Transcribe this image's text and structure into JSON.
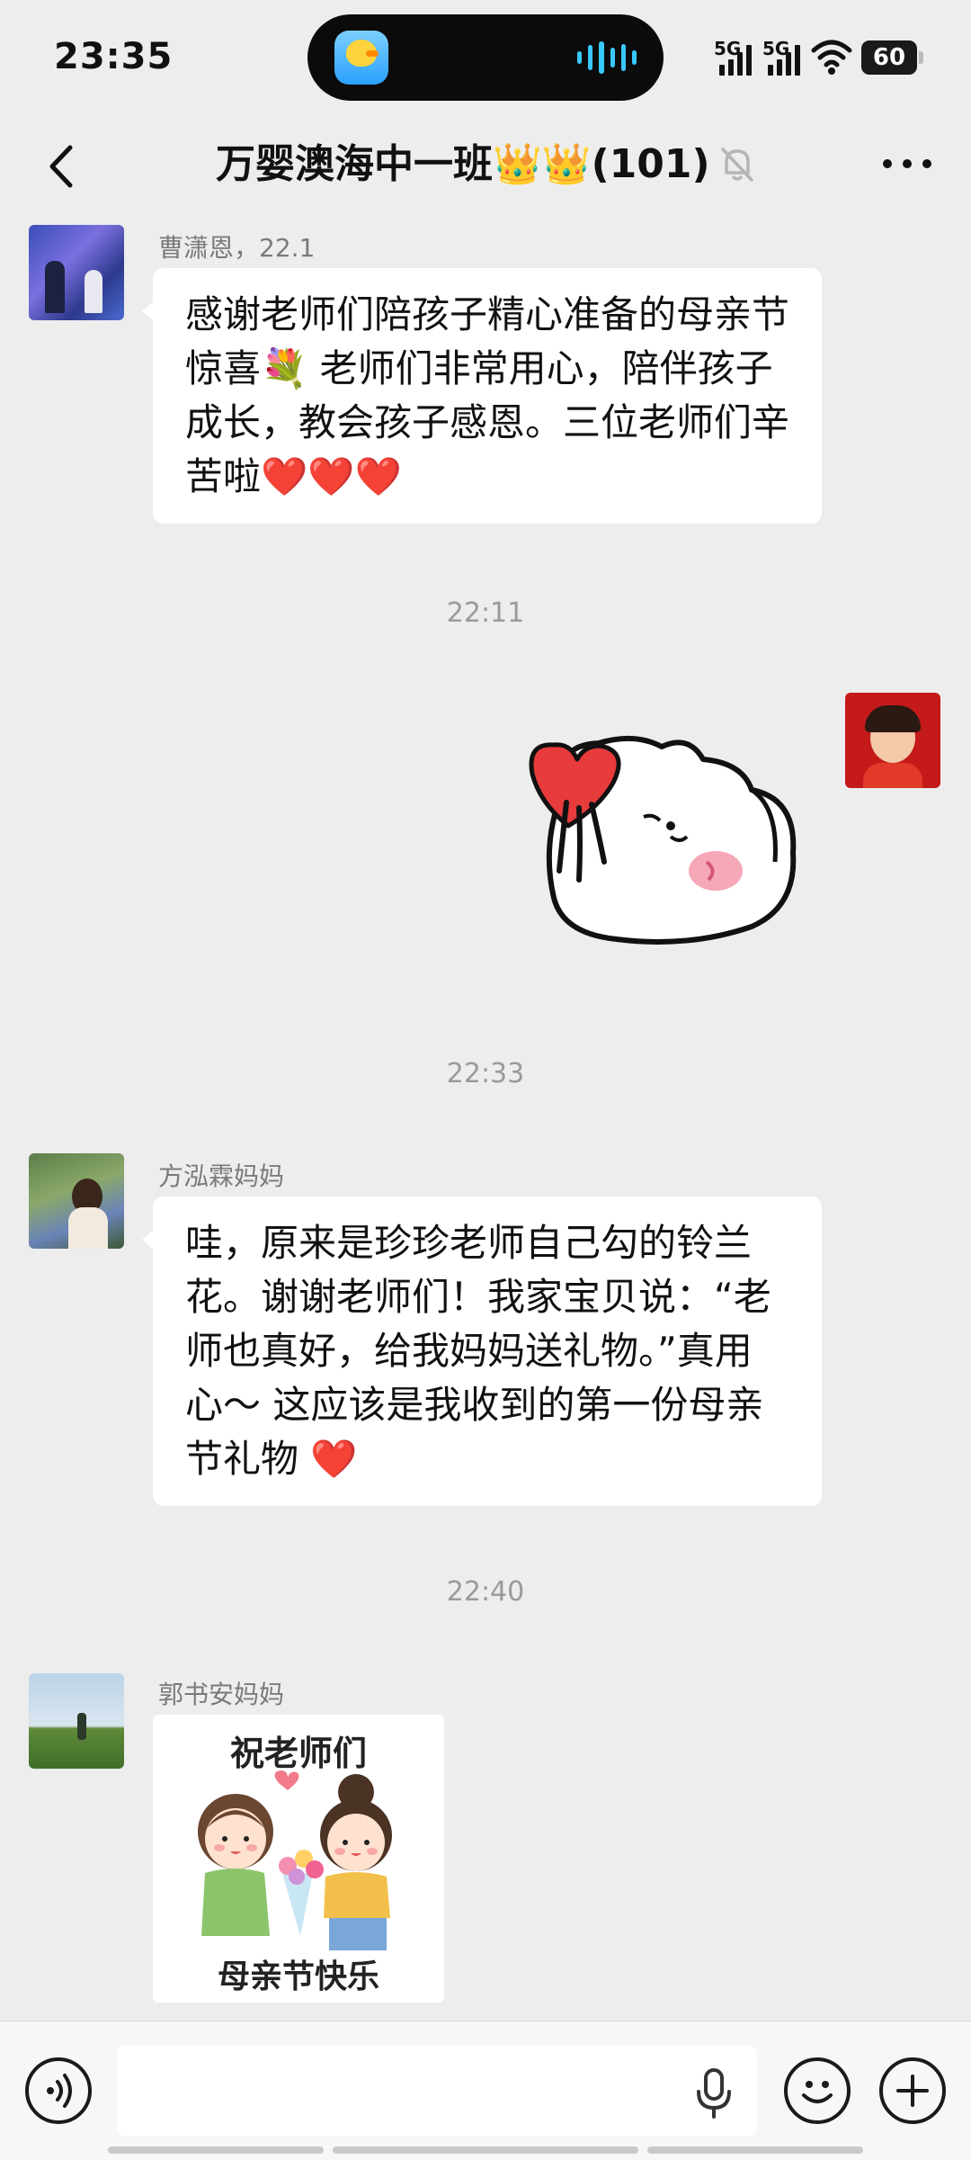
{
  "status_bar": {
    "time": "23:35",
    "net1": "5G",
    "net2": "5G",
    "battery": "60"
  },
  "header": {
    "title": "万婴澳海中一班👑👑(101)"
  },
  "messages": {
    "m1": {
      "sender": "曹潇恩，22.1",
      "text": "感谢老师们陪孩子精心准备的母亲节惊喜💐 老师们非常用心，陪伴孩子成长，教会孩子感恩。三位老师们辛苦啦❤️❤️❤️"
    },
    "t1": "22:11",
    "t2": "22:33",
    "m3": {
      "sender": "方泓霖妈妈",
      "text": "哇，原来是珍珍老师自己勾的铃兰花。谢谢老师们！我家宝贝说：“老师也真好，给我妈妈送礼物。”真用心～ 这应该是我收到的第一份母亲节礼物 ❤️"
    },
    "t3": "22:40",
    "m4": {
      "sender": "郭书安妈妈",
      "sticker_top": "祝老师们",
      "sticker_bottom": "母亲节快乐"
    }
  },
  "input": {
    "placeholder": ""
  },
  "icons": {
    "back": "chevron-left-icon",
    "mute": "bell-off-icon",
    "more": "more-dots-icon",
    "voice": "voice-toggle-icon",
    "mic": "microphone-icon",
    "emoji": "emoji-icon",
    "plus": "plus-icon"
  }
}
